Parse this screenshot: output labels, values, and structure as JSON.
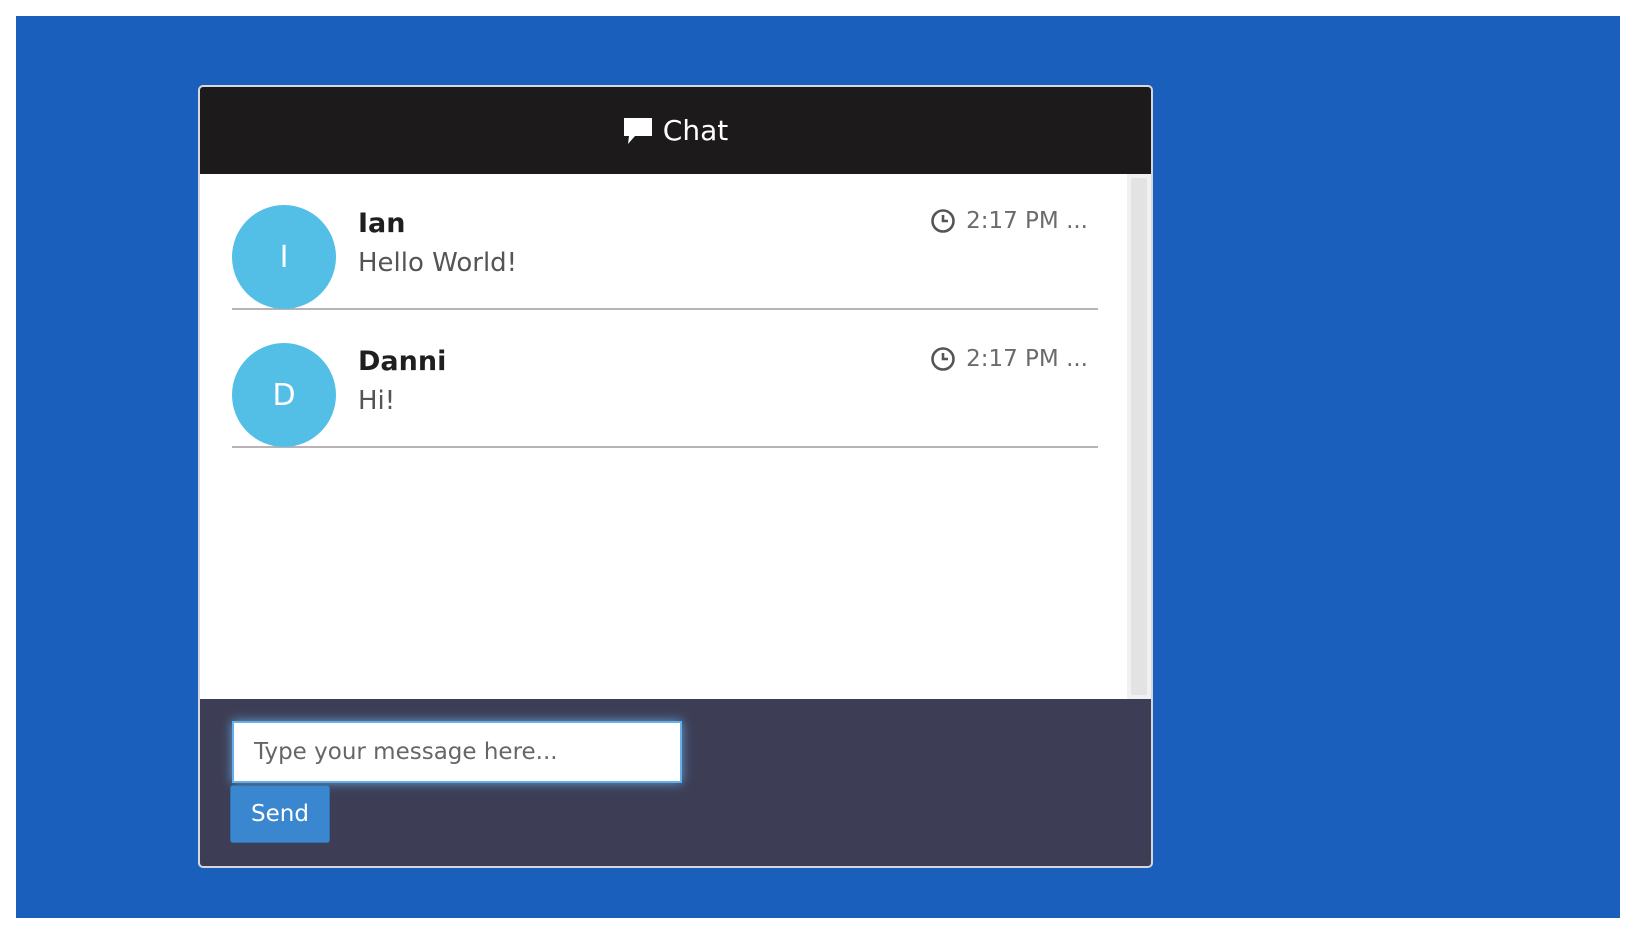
{
  "header": {
    "title": "Chat",
    "icon": "speech-bubble-icon"
  },
  "messages": [
    {
      "avatar_letter": "I",
      "sender": "Ian",
      "text": "Hello World!",
      "time": "2:17 PM ..."
    },
    {
      "avatar_letter": "D",
      "sender": "Danni",
      "text": "Hi!",
      "time": "2:17 PM ..."
    }
  ],
  "composer": {
    "placeholder": "Type your message here...",
    "value": "",
    "send_label": "Send"
  },
  "colors": {
    "background": "#1b5fbd",
    "header": "#1c1a1b",
    "avatar": "#54bfe6",
    "footer": "#3d3e56",
    "send_button": "#3a87cf"
  }
}
